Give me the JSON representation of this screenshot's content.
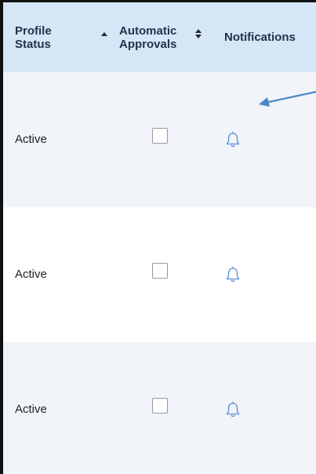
{
  "table": {
    "columns": [
      {
        "label": "Profile Status",
        "sort": "ascending"
      },
      {
        "label": "Automatic Approvals",
        "sort": "sortable"
      },
      {
        "label": "Notifications",
        "sort": "none"
      }
    ],
    "rows": [
      {
        "status": "Active",
        "automatic_approvals_checked": false,
        "notifications_icon": "bell-icon"
      },
      {
        "status": "Active",
        "automatic_approvals_checked": false,
        "notifications_icon": "bell-icon"
      },
      {
        "status": "Active",
        "automatic_approvals_checked": false,
        "notifications_icon": "bell-icon"
      }
    ]
  },
  "colors": {
    "header_background": "#d6e6f6",
    "row_alt_background": "#f1f4f8",
    "icon_accent": "#5b8ed6",
    "annotation_arrow": "#4a86c8"
  },
  "annotation": {
    "icon": "arrow-pointer-icon"
  }
}
